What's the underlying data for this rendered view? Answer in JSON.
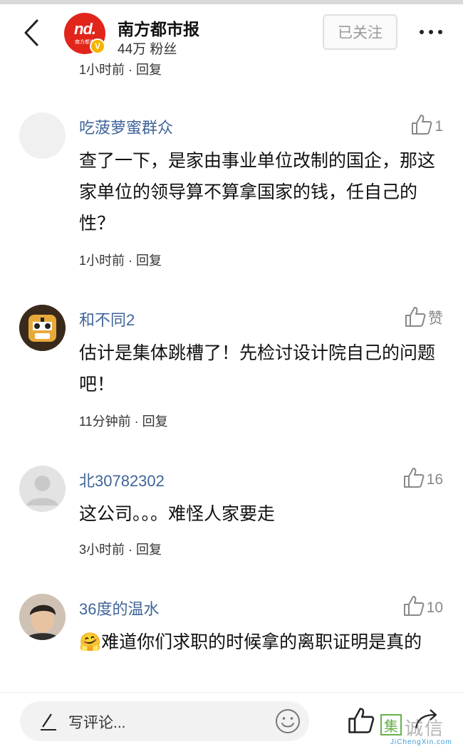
{
  "header": {
    "account_name": "南方都市报",
    "fans": "44万 粉丝",
    "follow_label": "已关注",
    "logo_text": "nd.",
    "logo_sub": "南方都市",
    "verify_badge": "V"
  },
  "first_meta": "1小时前 · 回复",
  "comments": [
    {
      "name": "吃菠萝蜜群众",
      "likes": "1",
      "text": "查了一下，是家由事业单位改制的国企，那这家单位的领导算不算拿国家的钱，任自己的性？",
      "meta": "1小时前 · 回复"
    },
    {
      "name": "和不同2",
      "likes": "赞",
      "text": "估计是集体跳槽了！先检讨设计院自己的问题吧！",
      "meta": "11分钟前 · 回复"
    },
    {
      "name": "北30782302",
      "likes": "16",
      "text": "这公司。。。难怪人家要走",
      "meta": "3小时前 · 回复"
    },
    {
      "name": "36度的温水",
      "likes": "10",
      "text": "🤗难道你们求职的时候拿的离职证明是真的",
      "meta": ""
    }
  ],
  "bottom": {
    "input_placeholder": "写评论..."
  },
  "watermark": {
    "box": "集",
    "text": "诚信",
    "url": "JiChengXin.com"
  }
}
